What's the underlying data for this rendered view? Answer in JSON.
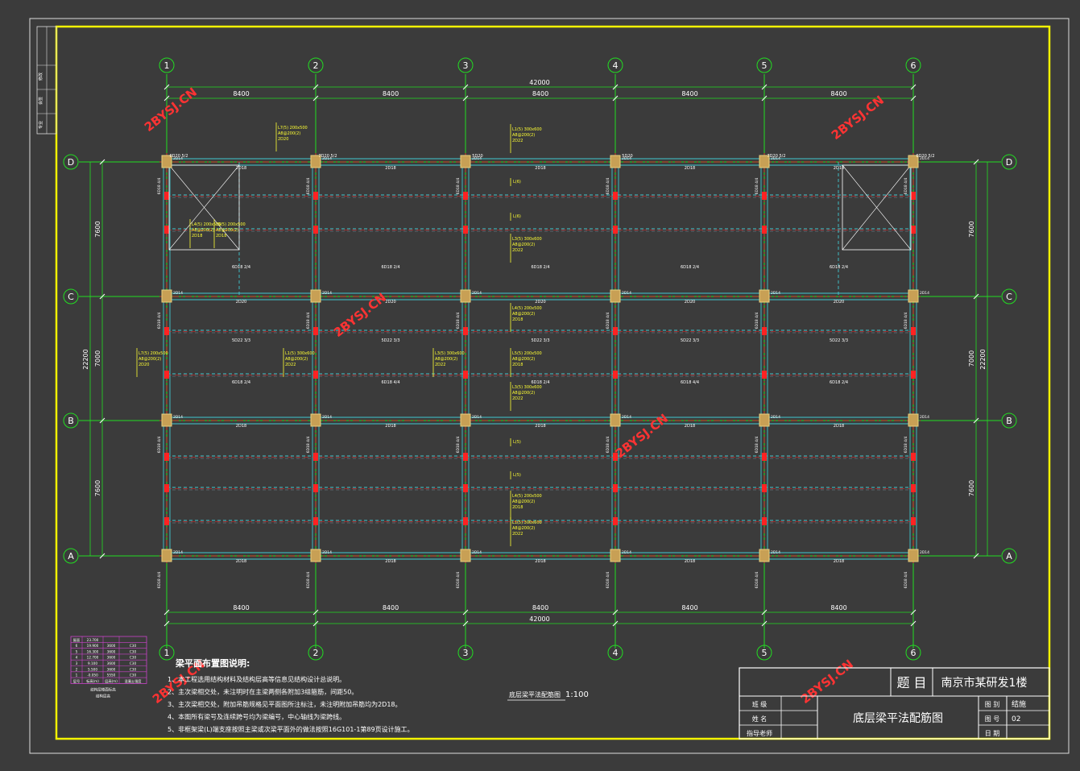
{
  "axes": {
    "columns": [
      "1",
      "2",
      "3",
      "4",
      "5",
      "6"
    ],
    "rows": [
      "D",
      "C",
      "B",
      "A"
    ]
  },
  "dims": {
    "spans": [
      "8400",
      "8400",
      "8400",
      "8400",
      "8400"
    ],
    "total": "42000",
    "row_spans": [
      "7600",
      "7000",
      "7600"
    ],
    "row_total": "22200"
  },
  "watermark": "2BYSJ.CN",
  "beam_labels": {
    "slab_lines": [
      "L(6)",
      "L(6)",
      "L(5)",
      "L(5)"
    ],
    "beams": [
      {
        "name": "L7(5) 200x500",
        "sub1": "A8@200(2)",
        "sub2": "2D20"
      },
      {
        "name": "L1(5) 300x600",
        "sub1": "A8@200(2)",
        "sub2": "2D22"
      },
      {
        "name": "L3(5) 300x600",
        "sub1": "A8@200(2)",
        "sub2": "2D22"
      },
      {
        "name": "L4(5) 200x500",
        "sub1": "A8@200(2)",
        "sub2": "2D18"
      },
      {
        "name": "L5(5) 200x500",
        "sub1": "A8@200(2)",
        "sub2": "2D18"
      }
    ],
    "bottom_bars": [
      "2D18",
      "2D18",
      "2D18",
      "2D18",
      "2D18"
    ],
    "mid_bars": [
      "6D18 2/4",
      "6D18 2/4",
      "5D22 3/3",
      "5D22 2/3",
      "6D18 4/4"
    ],
    "corner_bars": [
      "6D20 5/2",
      "7D20 5/2",
      "5D20",
      "5D20",
      "7D20 5/2",
      "6D20 5/2"
    ]
  },
  "notes": {
    "heading": "梁平面布置图说明:",
    "items": [
      "1、本工程选用结构材料及结构层高等信息见结构设计总说明。",
      "2、主次梁相交处，未注明时在主梁两侧各附加3组箍筋，间距50。",
      "3、主次梁相交处，附加吊筋规格见平面图所注标注，未注明附加吊筋均为2D18。",
      "4、本图所有梁号及连续跨号均为梁编号，中心轴线为梁跨线。",
      "5、非框架梁(L)端支座按照主梁或次梁平面外的做法按照16G101-1第89页设计施工。"
    ]
  },
  "plan_title": "底层梁平法配筋图",
  "plan_scale": "1:100",
  "title_block": {
    "subject_label": "题 目",
    "subject": "南京市某研发1楼",
    "drawing_name": "底层梁平法配筋图",
    "left_labels": [
      "班 级",
      "姓 名",
      "指导老师"
    ],
    "right_labels": [
      "图 别",
      "图 号",
      "日 期"
    ],
    "right_values": [
      "结施",
      "02",
      ""
    ]
  },
  "side_stamp": [
    "修改",
    "会签",
    "专业"
  ],
  "elevation_table": {
    "rows": [
      [
        "屋面",
        "23.700",
        "",
        ""
      ],
      [
        "6",
        "19.900",
        "3600",
        "C30"
      ],
      [
        "5",
        "16.300",
        "3600",
        "C30"
      ],
      [
        "4",
        "12.700",
        "3600",
        "C30"
      ],
      [
        "3",
        "9.100",
        "3600",
        "C30"
      ],
      [
        "2",
        "5.500",
        "3600",
        "C30"
      ],
      [
        "1",
        "-0.050",
        "5550",
        "C30"
      ]
    ],
    "footer": [
      "层号",
      "标高(m)",
      "层高(m)",
      "混凝土强度"
    ],
    "caption": "结构层楼面标高",
    "caption2": "结构层高"
  },
  "colors": {
    "background": "#3b3b3b",
    "frame": "#f4f400",
    "axis_green": "#22dd22",
    "beam_cyan": "#40c8d0",
    "text_yellow": "#ffff33",
    "red": "#ff2222",
    "column_fill": "#c8a055",
    "white": "#ffffff",
    "watermark": "#ff3333",
    "table_magenta": "#cc44cc"
  }
}
